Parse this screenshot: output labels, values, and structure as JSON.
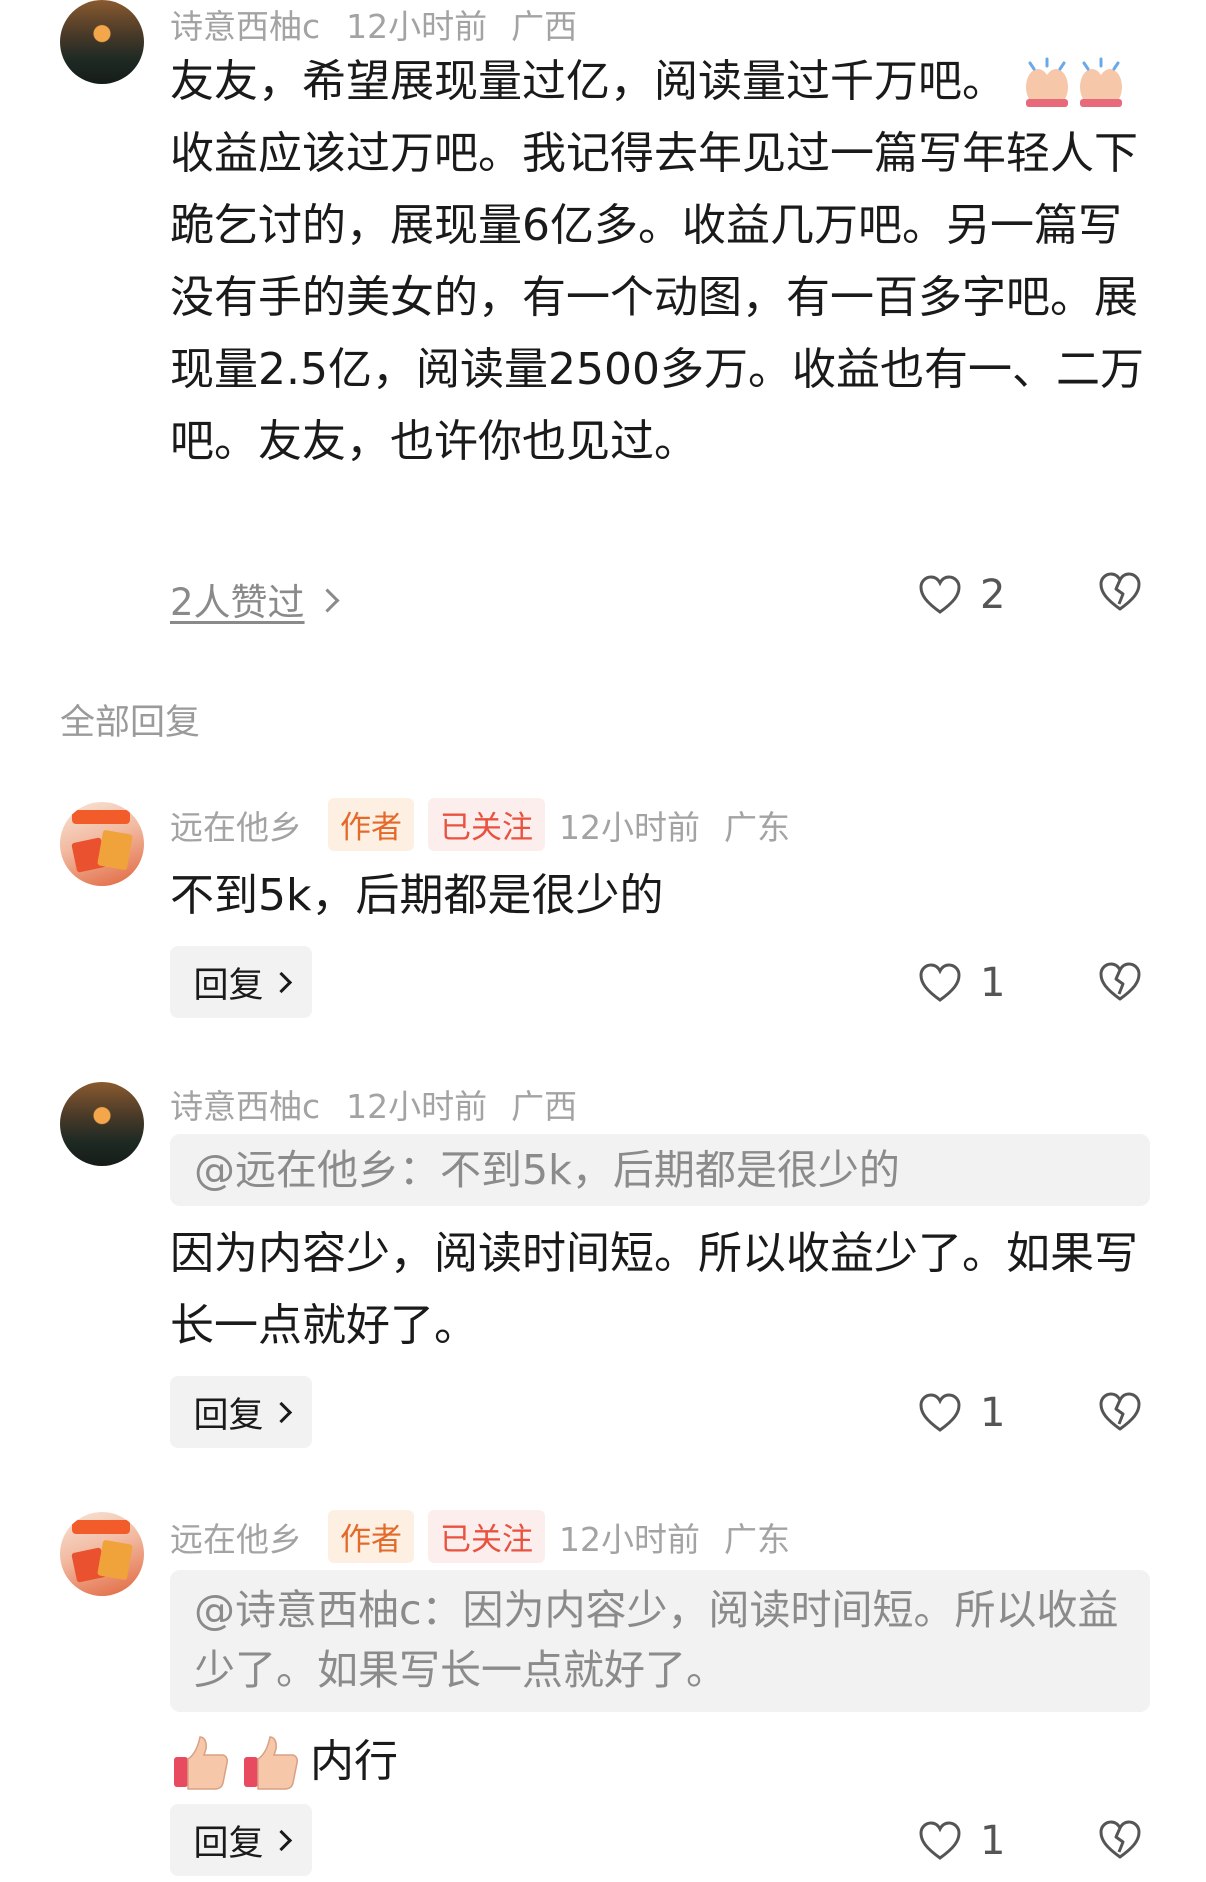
{
  "comment_main": {
    "user": "诗意西柚c",
    "time": "12小时前",
    "location": "广西",
    "text_line1": "友友，希望展现量过亿，阅读量过千万吧。",
    "text_rest": "收益应该过万吧。我记得去年见过一篇写年轻人下跪乞讨的，展现量6亿多。收益几万吧。另一篇写没有手的美女的，有一个动图，有一百多字吧。展现量2.5亿，阅读量2500多万。收益也有一、二万吧。友友，也许你也见过。",
    "likers": "2人赞过",
    "likes": "2",
    "emoji": "raising-hands-icon"
  },
  "section_title": "全部回复",
  "replies": [
    {
      "user": "远在他乡",
      "tag_author": "作者",
      "tag_follow": "已关注",
      "time": "12小时前",
      "location": "广东",
      "text": "不到5k，后期都是很少的",
      "reply_label": "回复",
      "likes": "1"
    },
    {
      "user": "诗意西柚c",
      "time": "12小时前",
      "location": "广西",
      "quote": "@远在他乡：不到5k，后期都是很少的",
      "text": "因为内容少，阅读时间短。所以收益少了。如果写长一点就好了。",
      "reply_label": "回复",
      "likes": "1"
    },
    {
      "user": "远在他乡",
      "tag_author": "作者",
      "tag_follow": "已关注",
      "time": "12小时前",
      "location": "广东",
      "quote": "@诗意西柚c：因为内容少，阅读时间短。所以收益少了。如果写长一点就好了。",
      "text": "内行",
      "emoji": "thumbs-up-icon",
      "reply_label": "回复",
      "likes": "1"
    }
  ]
}
